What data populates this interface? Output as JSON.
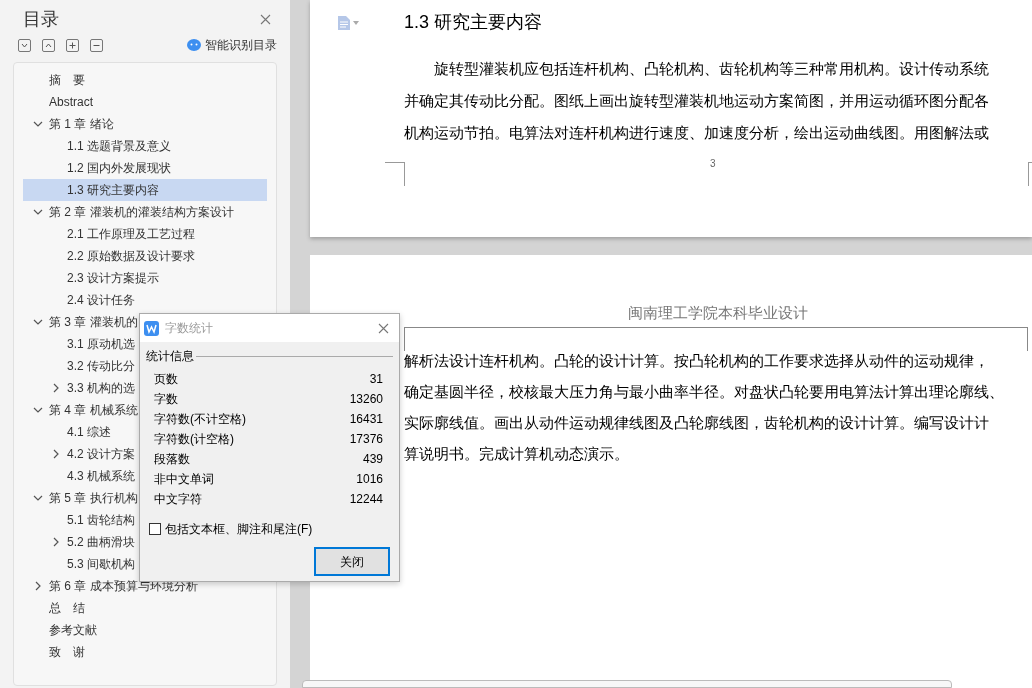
{
  "sidebar": {
    "title": "目录",
    "smart_recognize": "智能识别目录"
  },
  "toc": [
    {
      "label": "摘　要",
      "selected": false
    },
    {
      "label": "Abstract",
      "selected": false
    },
    {
      "label": "第 1 章  绪论",
      "selected": false,
      "expanded": true,
      "children": [
        {
          "label": "1.1 选题背景及意义",
          "selected": false
        },
        {
          "label": "1.2 国内外发展现状",
          "selected": false
        },
        {
          "label": "1.3 研究主要内容",
          "selected": true
        }
      ]
    },
    {
      "label": "第 2 章  灌装机的灌装结构方案设计",
      "selected": false,
      "expanded": true,
      "children": [
        {
          "label": "2.1 工作原理及工艺过程",
          "selected": false
        },
        {
          "label": "2.2 原始数据及设计要求",
          "selected": false
        },
        {
          "label": "2.3 设计方案提示",
          "selected": false
        },
        {
          "label": "2.4 设计任务",
          "selected": false
        }
      ]
    },
    {
      "label": "第 3 章  灌装机的",
      "selected": false,
      "expanded": true,
      "children": [
        {
          "label": "3.1 原动机选",
          "selected": false
        },
        {
          "label": "3.2 传动比分",
          "selected": false
        },
        {
          "label": "3.3 机构的选",
          "selected": false,
          "expanded": false
        }
      ]
    },
    {
      "label": "第 4 章  机械系统",
      "selected": false,
      "expanded": true,
      "children": [
        {
          "label": "4.1 综述",
          "selected": false
        },
        {
          "label": "4.2 设计方案",
          "selected": false,
          "expanded": false
        },
        {
          "label": "4.3 机械系统",
          "selected": false
        }
      ]
    },
    {
      "label": "第 5 章  执行机构",
      "selected": false,
      "expanded": true,
      "children": [
        {
          "label": "5.1 齿轮结构",
          "selected": false
        },
        {
          "label": "5.2 曲柄滑块",
          "selected": false,
          "expanded": false
        },
        {
          "label": "5.3  间歇机构",
          "selected": false
        }
      ]
    },
    {
      "label": "第 6 章  成本预算与环境分析",
      "selected": false,
      "expanded": false
    },
    {
      "label": "总　结",
      "selected": false
    },
    {
      "label": "参考文献",
      "selected": false
    },
    {
      "label": "致　谢",
      "selected": false
    }
  ],
  "pages": [
    {
      "heading": "1.3 研究主要内容",
      "indent": true,
      "lines": [
        "旋转型灌装机应包括连杆机构、凸轮机构、齿轮机构等三种常用机构。设计传动系统",
        "并确定其传动比分配。图纸上画出旋转型灌装机地运动方案简图，并用运动循环图分配各",
        "机构运动节拍。电算法对连杆机构进行速度、加速度分析，绘出运动曲线图。用图解法或"
      ],
      "page_number": "3"
    },
    {
      "header": "闽南理工学院本科毕业设计",
      "indent": false,
      "lines": [
        "解析法设计连杆机构。凸轮的设计计算。按凸轮机构的工作要求选择从动件的运动规律，",
        "确定基圆半径，校核最大压力角与最小曲率半径。对盘状凸轮要用电算法计算出理论廓线、",
        "实际廓线值。画出从动件运动规律线图及凸轮廓线图，齿轮机构的设计计算。编写设计计",
        "算说明书。完成计算机动态演示。"
      ]
    }
  ],
  "dialog": {
    "title": "字数统计",
    "group": "统计信息",
    "stats": [
      {
        "label": "页数",
        "value": "31"
      },
      {
        "label": "字数",
        "value": "13260"
      },
      {
        "label": "字符数(不计空格)",
        "value": "16431"
      },
      {
        "label": "字符数(计空格)",
        "value": "17376"
      },
      {
        "label": "段落数",
        "value": "439"
      },
      {
        "label": "非中文单词",
        "value": "1016"
      },
      {
        "label": "中文字符",
        "value": "12244"
      }
    ],
    "checkbox": {
      "label": "包括文本框、脚注和尾注(F)",
      "checked": false
    },
    "button": "关闭"
  }
}
